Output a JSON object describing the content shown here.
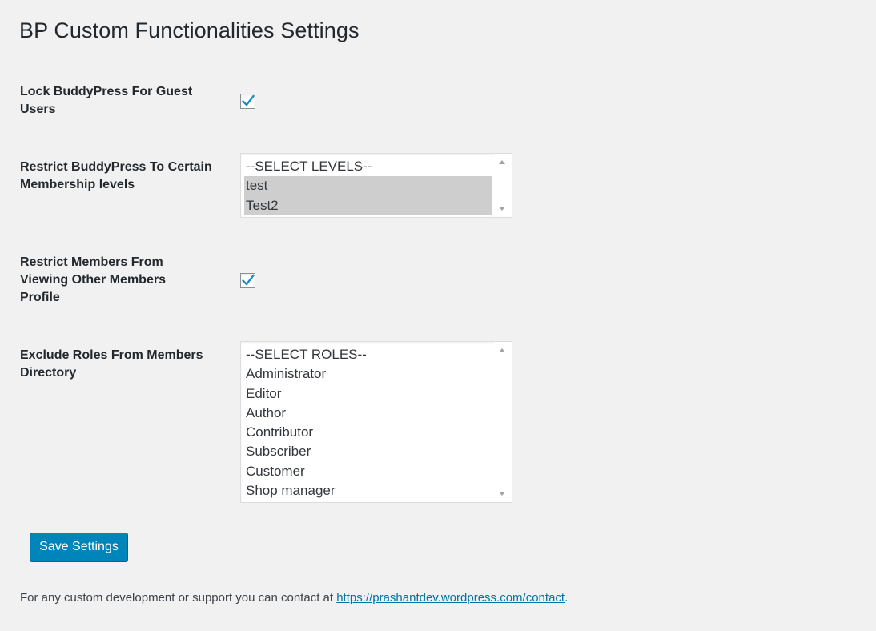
{
  "page": {
    "title": "BP Custom Functionalities Settings"
  },
  "settings": {
    "lock_guest": {
      "label": "Lock BuddyPress For Guest Users",
      "checked": true
    },
    "restrict_levels": {
      "label": "Restrict BuddyPress To Certain Membership levels",
      "options": [
        {
          "label": "--SELECT LEVELS--",
          "selected": false
        },
        {
          "label": "test",
          "selected": true
        },
        {
          "label": "Test2",
          "selected": true
        }
      ]
    },
    "restrict_profiles": {
      "label": "Restrict Members From Viewing Other Members Profile",
      "checked": true
    },
    "exclude_roles": {
      "label": "Exclude Roles From Members Directory",
      "options": [
        {
          "label": "--SELECT ROLES--",
          "selected": false
        },
        {
          "label": "Administrator",
          "selected": false
        },
        {
          "label": "Editor",
          "selected": false
        },
        {
          "label": "Author",
          "selected": false
        },
        {
          "label": "Contributor",
          "selected": false
        },
        {
          "label": "Subscriber",
          "selected": false
        },
        {
          "label": "Customer",
          "selected": false
        },
        {
          "label": "Shop manager",
          "selected": false
        }
      ]
    }
  },
  "actions": {
    "save_label": "Save Settings"
  },
  "footer": {
    "text": "For any custom development or support you can contact at ",
    "link_text": "https://prashantdev.wordpress.com/contact",
    "suffix": "."
  },
  "colors": {
    "primary_button": "#0085ba",
    "link": "#0073aa",
    "checkmark": "#1e8cbe",
    "selected_option": "#cecece",
    "background": "#f1f1f1"
  }
}
